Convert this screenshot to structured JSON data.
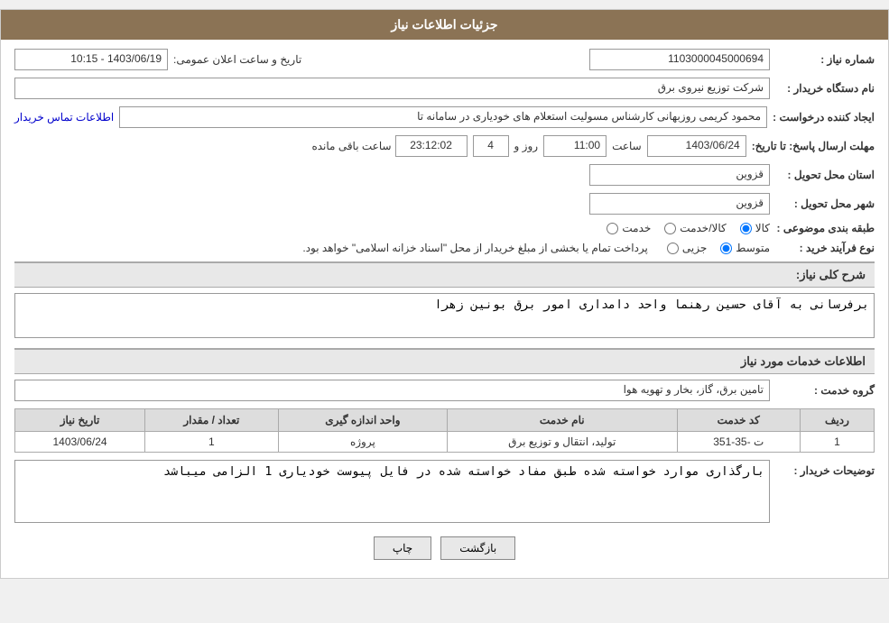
{
  "page": {
    "title": "جزئیات اطلاعات نیاز"
  },
  "header": {
    "announce_label": "تاریخ و ساعت اعلان عمومی:",
    "announce_value": "1403/06/19 - 10:15",
    "need_number_label": "شماره نیاز :",
    "need_number_value": "1103000045000694",
    "buyer_name_label": "نام دستگاه خریدار :",
    "buyer_name_value": "شرکت توزیع نیروی برق",
    "creator_label": "ایجاد کننده درخواست :",
    "creator_value": "محمود کریمی روزبهانی کارشناس  مسولیت استعلام های خودیاری در سامانه تا",
    "creator_link": "اطلاعات تماس خریدار",
    "reply_deadline_label": "مهلت ارسال پاسخ: تا تاریخ:",
    "reply_date": "1403/06/24",
    "reply_time_label": "ساعت",
    "reply_time": "11:00",
    "reply_day_label": "روز و",
    "reply_days": "4",
    "remaining_label": "ساعت باقی مانده",
    "remaining_time": "23:12:02",
    "province_label": "استان محل تحویل :",
    "province_value": "قزوین",
    "city_label": "شهر محل تحویل :",
    "city_value": "قزوین",
    "category_label": "طبقه بندی موضوعی :",
    "category_options": [
      {
        "label": "خدمت",
        "value": "service"
      },
      {
        "label": "کالا/خدمت",
        "value": "both"
      },
      {
        "label": "کالا",
        "value": "goods",
        "selected": true
      }
    ],
    "purchase_type_label": "نوع فرآیند خرید :",
    "purchase_type_options": [
      {
        "label": "جزیی",
        "value": "partial"
      },
      {
        "label": "متوسط",
        "value": "medium",
        "selected": true
      }
    ],
    "purchase_note": "پرداخت تمام یا بخشی از مبلغ خریدار از محل \"اسناد خزانه اسلامی\" خواهد بود."
  },
  "need_description": {
    "section_title": "شرح کلی نیاز:",
    "value": "برفرسانی به آقای حسین رهنما واحد دامداری امور برق بونین زهرا"
  },
  "services_section": {
    "section_title": "اطلاعات خدمات مورد نیاز",
    "service_group_label": "گروه خدمت :",
    "service_group_value": "تامین برق، گاز، بخار و تهویه هوا",
    "table": {
      "headers": [
        "ردیف",
        "کد خدمت",
        "نام خدمت",
        "واحد اندازه گیری",
        "تعداد / مقدار",
        "تاریخ نیاز"
      ],
      "rows": [
        {
          "row_num": "1",
          "service_code": "ت -35-351",
          "service_name": "تولید، انتقال و توزیع برق",
          "unit": "پروژه",
          "quantity": "1",
          "date": "1403/06/24"
        }
      ]
    }
  },
  "buyer_notes": {
    "section_label": "توضیحات خریدار :",
    "value": "بارگذاری موارد خواسته شده طبق مفاد خواسته شده در فایل پیوست خودیاری 1 الزامی میباشد"
  },
  "buttons": {
    "print_label": "چاپ",
    "back_label": "بازگشت"
  }
}
